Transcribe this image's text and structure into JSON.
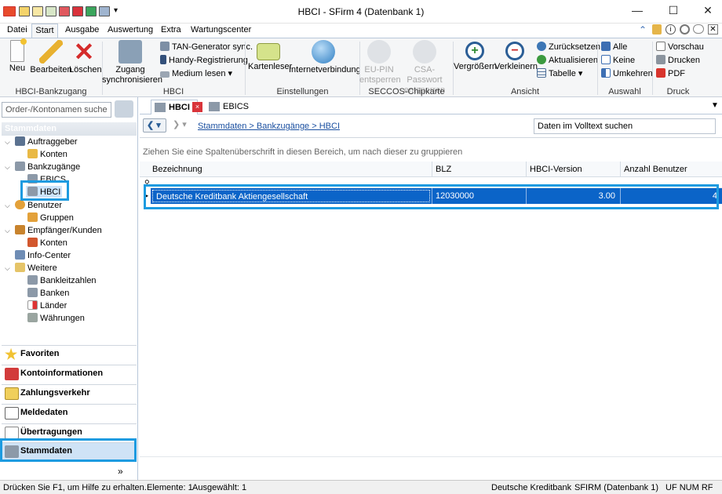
{
  "window": {
    "title": "HBCI - SFirm 4 (Datenbank 1)",
    "minimize": "—",
    "maximize": "☐",
    "close": "✕"
  },
  "menu": {
    "tabs": [
      "Datei",
      "Start",
      "Ausgabe",
      "Auswertung",
      "Extra",
      "Wartungscenter"
    ],
    "active": "Start"
  },
  "ribbon": {
    "groups": [
      {
        "label": "HBCI-Bankzugang",
        "buttons": [
          "Neu",
          "Bearbeiten",
          "Löschen"
        ]
      },
      {
        "label": "HBCI",
        "big": "Zugang synchronisieren",
        "small": [
          "TAN-Generator sync.",
          "Handy-Registrierung",
          "Medium lesen ▾"
        ]
      },
      {
        "label": "Einstellungen",
        "buttons": [
          "Kartenleser",
          "Internetverbindung"
        ]
      },
      {
        "label": "SECCOS-Chipkarte",
        "buttons": [
          "EU-PIN entsperren",
          "CSA-Passwort entsperren"
        ]
      },
      {
        "label": "Ansicht",
        "buttons": [
          "Vergrößern",
          "Verkleinern"
        ],
        "small": [
          "Zurücksetzen",
          "Aktualisieren",
          "Tabelle ▾"
        ]
      },
      {
        "label": "Auswahl",
        "small": [
          "Alle",
          "Keine",
          "Umkehren"
        ]
      },
      {
        "label": "Druck",
        "small": [
          "Vorschau",
          "Drucken",
          "PDF"
        ]
      }
    ]
  },
  "sidebar": {
    "search_placeholder": "Order-/Kontonamen suche",
    "header": "Stammdaten",
    "tree": [
      {
        "label": "Auftraggeber",
        "level": 0
      },
      {
        "label": "Konten",
        "level": 1
      },
      {
        "label": "Bankzugänge",
        "level": 0
      },
      {
        "label": "EBICS",
        "level": 1
      },
      {
        "label": "HBCI",
        "level": 1,
        "selected": true
      },
      {
        "label": "Benutzer",
        "level": 0
      },
      {
        "label": "Gruppen",
        "level": 1
      },
      {
        "label": "Empfänger/Kunden",
        "level": 0
      },
      {
        "label": "Konten",
        "level": 1
      },
      {
        "label": "Info-Center",
        "level": 0
      },
      {
        "label": "Weitere",
        "level": 0
      },
      {
        "label": "Bankleitzahlen",
        "level": 1
      },
      {
        "label": "Banken",
        "level": 1
      },
      {
        "label": "Länder",
        "level": 1
      },
      {
        "label": "Währungen",
        "level": 1
      }
    ],
    "nav": [
      "Favoriten",
      "Kontoinformationen",
      "Zahlungsverkehr",
      "Meldedaten",
      "Übertragungen",
      "Stammdaten"
    ],
    "more": "»"
  },
  "content": {
    "tabs": [
      "HBCI",
      "EBICS"
    ],
    "breadcrumb": "Stammdaten > Bankzugänge > HBCI",
    "fulltext_placeholder": "Daten im Volltext suchen",
    "group_hint": "Ziehen Sie eine Spaltenüberschrift in diesen Bereich, um nach dieser zu gruppieren",
    "columns": [
      "Bezeichnung",
      "BLZ",
      "HBCI-Version",
      "Anzahl Benutzer"
    ],
    "rows": [
      {
        "bezeichnung": "Deutsche Kreditbank Aktiengesellschaft",
        "blz": "12030000",
        "version": "3.00",
        "anzahl": "4"
      }
    ]
  },
  "status": {
    "help": "Drücken Sie F1, um Hilfe zu erhalten.",
    "elemente": "Elemente: 1",
    "ausgewaehlt": "Ausgewählt: 1",
    "bank": "Deutsche Kreditbank Be",
    "db": "SFIRM (Datenbank 1)",
    "flags": "UF  NUM  RF"
  },
  "colors": {
    "highlight": "#1d9be0",
    "selection": "#0b64c8",
    "ribbon_bg": "#f5f6f7"
  }
}
